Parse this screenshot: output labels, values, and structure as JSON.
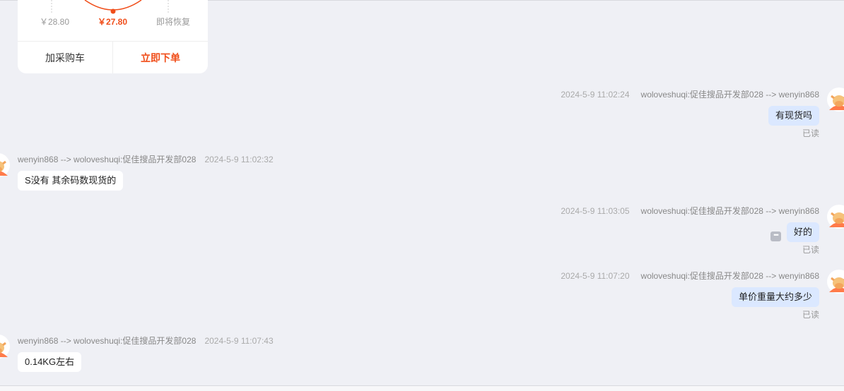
{
  "card": {
    "prices": [
      "￥28.80",
      "￥27.80",
      "即将恢复"
    ],
    "add_cart_label": "加采购车",
    "buy_now_label": "立即下单",
    "accent_color": "#f04d19"
  },
  "messages": [
    {
      "side": "right",
      "time": "2024-5-9 11:02:24",
      "route": "woloveshuqi:促佳搜品开发部028 --> wenyin868",
      "text": "有现货吗",
      "status": "已读"
    },
    {
      "side": "left",
      "time": "2024-5-9 11:02:32",
      "route": "wenyin868 --> woloveshuqi:促佳搜品开发部028",
      "text": "S没有 其余码数现货的"
    },
    {
      "side": "right",
      "time": "2024-5-9 11:03:05",
      "route": "woloveshuqi:促佳搜品开发部028 --> wenyin868",
      "text": "好的",
      "status": "已读"
    },
    {
      "side": "right",
      "time": "2024-5-9 11:07:20",
      "route": "woloveshuqi:促佳搜品开发部028 --> wenyin868",
      "text": "单价重量大约多少",
      "status": "已读"
    },
    {
      "side": "left",
      "time": "2024-5-9 11:07:43",
      "route": "wenyin868 --> woloveshuqi:促佳搜品开发部028",
      "text": "0.14KG左右"
    }
  ],
  "icons": {
    "avatar": "cow-avatar-icon",
    "more": "more-options-icon"
  },
  "colors": {
    "background": "#eff0f5",
    "outgoing_bubble": "#dbe8ff",
    "incoming_bubble": "#ffffff"
  }
}
